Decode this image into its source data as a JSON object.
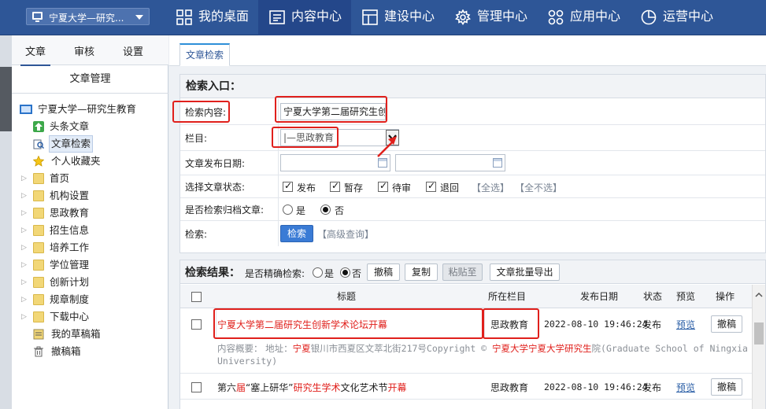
{
  "topbar": {
    "site_name": "宁夏大学—研究...",
    "nav": [
      {
        "label": "我的桌面",
        "icon": "grid-icon"
      },
      {
        "label": "内容中心",
        "icon": "document-icon",
        "active": true
      },
      {
        "label": "建设中心",
        "icon": "layout-icon"
      },
      {
        "label": "管理中心",
        "icon": "gear-icon"
      },
      {
        "label": "应用中心",
        "icon": "apps-icon"
      },
      {
        "label": "运营中心",
        "icon": "pie-chart-icon"
      }
    ]
  },
  "sidebar": {
    "tabs": [
      "文章",
      "审核",
      "设置"
    ],
    "section_title": "文章管理",
    "root": "宁夏大学—研究生教育",
    "items": [
      {
        "label": "头条文章",
        "icon": "arrow-up-icon"
      },
      {
        "label": "文章检索",
        "icon": "search-doc-icon",
        "selected": true
      },
      {
        "label": "个人收藏夹",
        "icon": "star-icon"
      },
      {
        "label": "首页",
        "icon": "folder-icon"
      },
      {
        "label": "机构设置",
        "icon": "folder-icon"
      },
      {
        "label": "思政教育",
        "icon": "folder-icon"
      },
      {
        "label": "招生信息",
        "icon": "folder-icon"
      },
      {
        "label": "培养工作",
        "icon": "folder-icon"
      },
      {
        "label": "学位管理",
        "icon": "folder-icon"
      },
      {
        "label": "创新计划",
        "icon": "folder-icon"
      },
      {
        "label": "规章制度",
        "icon": "folder-icon"
      },
      {
        "label": "下载中心",
        "icon": "folder-icon"
      },
      {
        "label": "我的草稿箱",
        "icon": "draft-icon"
      },
      {
        "label": "撤稿箱",
        "icon": "trash-icon"
      }
    ]
  },
  "main": {
    "tab": "文章检索",
    "search": {
      "heading": "检索入口：",
      "content_label": "检索内容:",
      "content_value": "宁夏大学第二届研究生创",
      "column_label": "栏目:",
      "column_value": "|—思政教育",
      "date_label": "文章发布日期:",
      "status_label": "选择文章状态:",
      "statuses": [
        {
          "label": "发布",
          "checked": true
        },
        {
          "label": "暂存",
          "checked": true
        },
        {
          "label": "待审",
          "checked": true
        },
        {
          "label": "退回",
          "checked": true
        }
      ],
      "select_all": "【全选】",
      "select_none": "【全不选】",
      "archive_label": "是否检索归档文章:",
      "archive_yes": "是",
      "archive_no": "否",
      "search_label": "检索:",
      "search_button": "检索",
      "advanced": "【高级查询】"
    },
    "results": {
      "heading": "检索结果：",
      "exact_label": "是否精确检索:",
      "exact_yes": "是",
      "exact_no": "否",
      "buttons": [
        "撤稿",
        "复制",
        "粘贴至",
        "文章批量导出"
      ],
      "columns": [
        "标题",
        "所在栏目",
        "发布日期",
        "状态",
        "预览",
        "操作"
      ],
      "rows": [
        {
          "title": "宁夏大学第二届研究生创新学术论坛开幕",
          "column": "思政教育",
          "date": "2022-08-10 19:46:24",
          "status": "发布",
          "preview": "预览",
          "action": "撤稿",
          "summary_prefix": "内容概要：  地址：",
          "summary_hl1": "宁夏",
          "summary_mid": "银川市西夏区文萃北街217号Copyright © ",
          "summary_hl2": "宁夏大学宁夏大学研究生",
          "summary_tail": "院(Graduate School of Ningxia University)"
        },
        {
          "title_parts": [
            "第六",
            "届",
            "“塞上研华”",
            "研究生学术",
            "文化艺术节",
            "开幕"
          ],
          "column": "思政教育",
          "date": "2022-08-10 19:46:24",
          "status": "发布",
          "preview": "预览",
          "action": "撤稿"
        }
      ]
    }
  }
}
